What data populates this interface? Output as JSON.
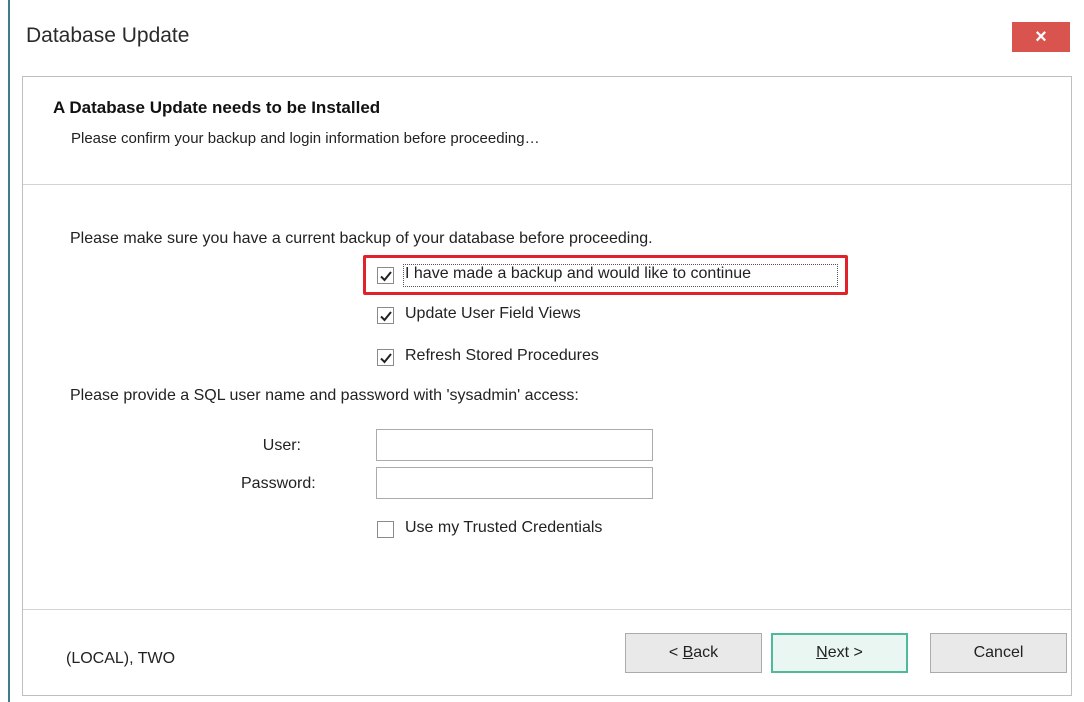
{
  "window": {
    "title": "Database Update",
    "close_glyph": "×"
  },
  "header": {
    "title": "A Database Update needs to be Installed",
    "subtitle": "Please confirm your backup and login information before proceeding…"
  },
  "body": {
    "backup_prompt": "Please make sure you have a current backup of your database before proceeding.",
    "options": [
      {
        "label": "I have made a backup and would like to continue",
        "checked": true
      },
      {
        "label": "Update User Field Views",
        "checked": true
      },
      {
        "label": "Refresh Stored Procedures",
        "checked": true
      }
    ],
    "sql_prompt": "Please provide a SQL user name and password with 'sysadmin' access:",
    "user_label": "User:",
    "user_value": "",
    "password_label": "Password:",
    "password_value": "",
    "trusted": {
      "label": "Use my Trusted Credentials",
      "checked": false
    }
  },
  "footer": {
    "status": "(LOCAL), TWO",
    "back_prefix": "< ",
    "back_hotkey": "B",
    "back_rest": "ack",
    "next_hotkey": "N",
    "next_rest": "ext >",
    "cancel": "Cancel"
  },
  "colors": {
    "close_bg": "#d9534f",
    "highlight": "#e0232a",
    "next_border": "#4fb99a"
  }
}
